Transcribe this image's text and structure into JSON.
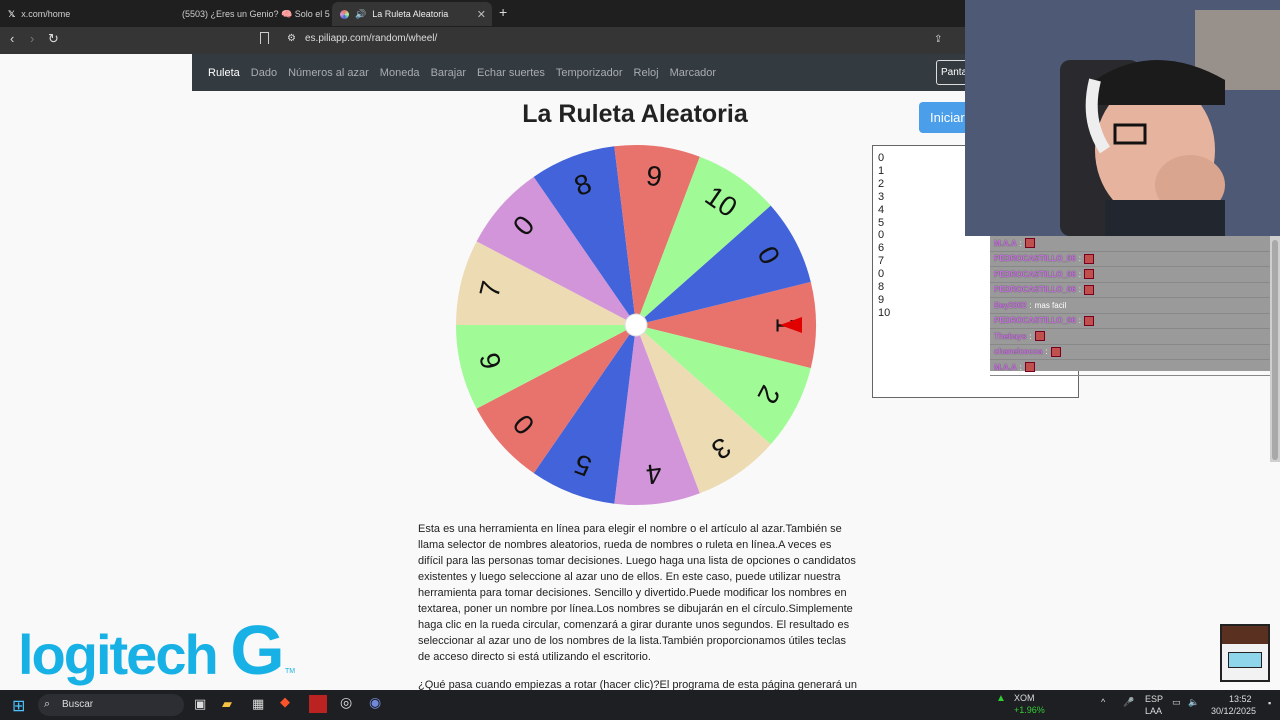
{
  "browser": {
    "tabs": [
      {
        "label": "x.com/home",
        "icon": "x-logo-icon"
      },
      {
        "label": "(5503) ¿Eres un Genio? 🧠 Solo el 5%",
        "icon": "youtube-icon"
      },
      {
        "label": "La Ruleta Aleatoria",
        "icon": "wheel-favicon-icon",
        "active": true
      }
    ],
    "url": "es.piliapp.com/random/wheel/"
  },
  "site_nav": {
    "items": [
      "Ruleta",
      "Dado",
      "Números al azar",
      "Moneda",
      "Barajar",
      "Echar suertes",
      "Temporizador",
      "Reloj",
      "Marcador"
    ],
    "active": "Ruleta",
    "panta_button": "Panta"
  },
  "page": {
    "title": "La Ruleta Aleatoria",
    "start_button": "Iniciar"
  },
  "wheel": {
    "segments": [
      {
        "label": "1",
        "color": "#e8736d"
      },
      {
        "label": "2",
        "color": "#a0fb97"
      },
      {
        "label": "3",
        "color": "#eddcb3"
      },
      {
        "label": "4",
        "color": "#d295d9"
      },
      {
        "label": "5",
        "color": "#4263d9"
      },
      {
        "label": "0",
        "color": "#e8736d"
      },
      {
        "label": "6",
        "color": "#a0fb97"
      },
      {
        "label": "7",
        "color": "#eddcb3"
      },
      {
        "label": "0",
        "color": "#d295d9"
      },
      {
        "label": "8",
        "color": "#4263d9"
      },
      {
        "label": "9",
        "color": "#e8736d"
      },
      {
        "label": "10",
        "color": "#a0fb97"
      },
      {
        "label": "0",
        "color": "#4263d9"
      }
    ],
    "pointer_color": "#e00000"
  },
  "names_list": [
    "0",
    "1",
    "2",
    "3",
    "4",
    "5",
    "0",
    "6",
    "7",
    "0",
    "8",
    "9",
    "10"
  ],
  "chat": [
    {
      "user": "M.A.A",
      "text": ""
    },
    {
      "user": "PEDROCASTILLO_06",
      "text": ""
    },
    {
      "user": "PEDROCASTILLO_06",
      "text": ""
    },
    {
      "user": "PEDROCASTILLO_06",
      "text": ""
    },
    {
      "user": "Bey2002",
      "text": "mas facil"
    },
    {
      "user": "PEDROCASTILLO_06",
      "text": ""
    },
    {
      "user": "Thebays",
      "text": ""
    },
    {
      "user": "chanelcocoa",
      "text": ""
    },
    {
      "user": "M.A.A",
      "text": ""
    }
  ],
  "description": {
    "p1": "Esta es una herramienta en línea para elegir el nombre o el artículo al azar.También se llama selector de nombres aleatorios, rueda de nombres o ruleta en línea.A veces es difícil para las personas tomar decisiones. Luego haga una lista de opciones o candidatos existentes y luego seleccione al azar uno de ellos. En este caso, puede utilizar nuestra herramienta para tomar decisiones. Sencillo y divertido.Puede modificar los nombres en textarea, poner un nombre por línea.Los nombres se dibujarán en el círculo.Simplemente haga clic en la rueda circular, comenzará a girar durante unos segundos. El resultado es seleccionar al azar uno de los nombres de la lista.También proporcionamos útiles teclas de acceso directo si está utilizando el escritorio.",
    "p2": "¿Qué pasa cuando empiezas a rotar (hacer clic)?El programa de esta página generará un"
  },
  "overlay": {
    "logo_text": "logitech",
    "logo_mark": "G",
    "tm": "TM"
  },
  "taskbar": {
    "search": "Buscar",
    "stock_name": "XOM",
    "stock_change": "+1.96%",
    "lang1": "ESP",
    "lang2": "LAA",
    "time": "13:52",
    "date": "30/12/2025"
  }
}
